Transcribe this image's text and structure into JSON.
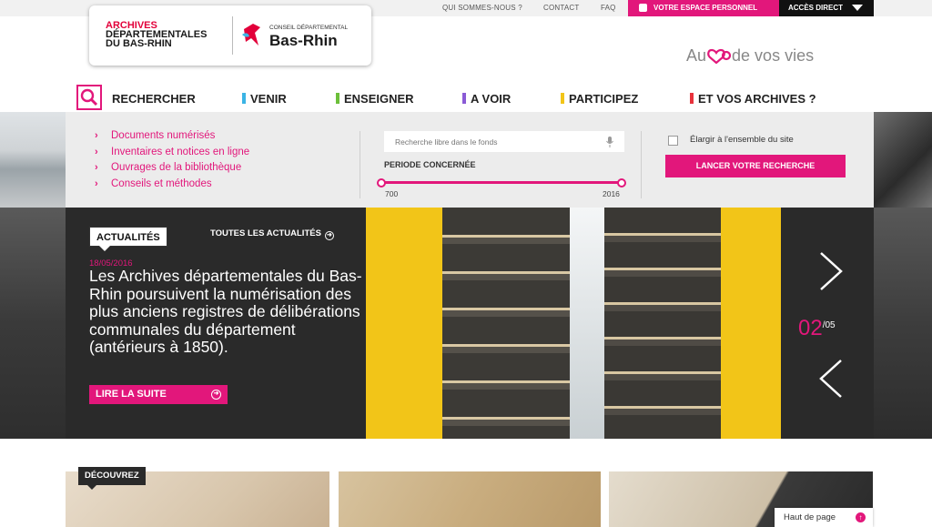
{
  "topbar": {
    "qui": "QUI SOMMES-NOUS ?",
    "contact": "CONTACT",
    "faq": "FAQ",
    "espace": "VOTRE ESPACE PERSONNEL",
    "acces": "ACCÈS DIRECT"
  },
  "logo": {
    "line1": "ARCHIVES",
    "line2": "DÉPARTEMENTALES",
    "line3": "DU BAS-RHIN",
    "conseil_small": "CONSEIL DÉPARTEMENTAL",
    "conseil_big": "Bas-Rhin"
  },
  "slogan": {
    "left": "Au",
    "right": "de vos vies"
  },
  "nav": {
    "rechercher": "RECHERCHER",
    "venir": "VENIR",
    "enseigner": "ENSEIGNER",
    "avoir": "A VOIR",
    "participez": "PARTICIPEZ",
    "archives": "ET VOS ARCHIVES ?",
    "colors": {
      "venir": "#3bb4e5",
      "enseigner": "#6cbf3a",
      "avoir": "#8a5ad6",
      "participez": "#f2c518",
      "archives": "#e8323c"
    }
  },
  "search": {
    "links": [
      "Documents numérisés",
      "Inventaires et notices en ligne",
      "Ouvrages de la bibliothèque",
      "Conseils et méthodes"
    ],
    "placeholder": "Recherche libre dans le fonds",
    "periode": "PERIODE CONCERNÉE",
    "min": "700",
    "max": "2016",
    "elargir": "Élargir à l'ensemble du site",
    "lancer": "LANCER VOTRE RECHERCHE"
  },
  "news": {
    "tag": "ACTUALITÉS",
    "toutes": "TOUTES LES ACTUALITÉS",
    "date": "18/05/2016",
    "headline": "Les Archives départementales du Bas-Rhin poursuivent la numérisation des plus anciens registres de délibérations communales du département (antérieurs à 1850).",
    "lire": "LIRE LA SUITE",
    "current": "02",
    "total": "/05"
  },
  "bottom": {
    "decouvrez": "DÉCOUVREZ",
    "haut": "Haut de page"
  },
  "accent": "#e2177b"
}
